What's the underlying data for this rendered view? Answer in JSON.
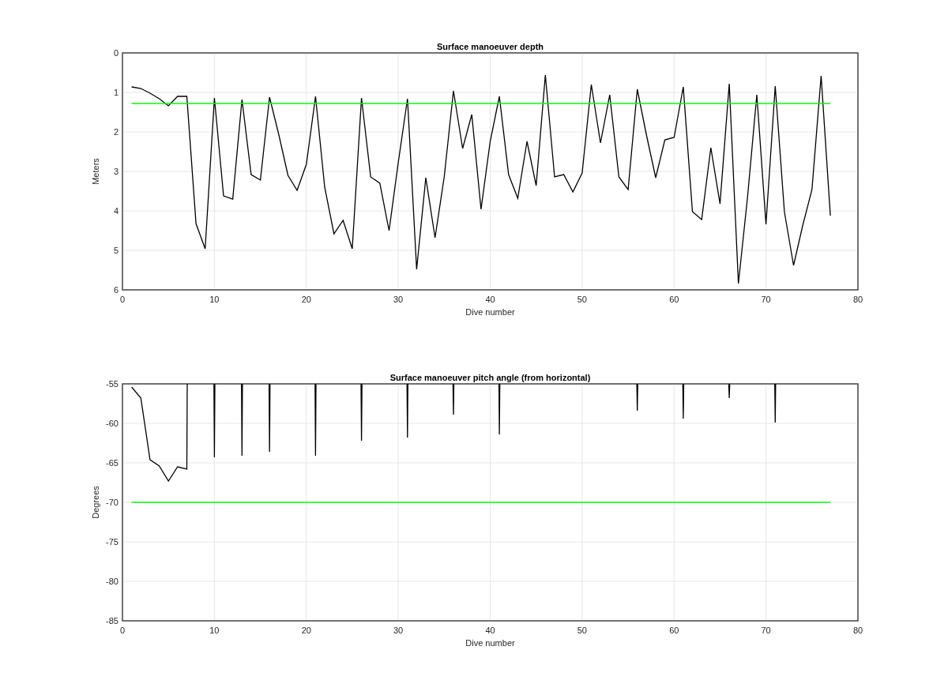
{
  "charts": [
    {
      "chart_data": {
        "type": "line",
        "title": "Surface manoeuver depth",
        "xlabel": "Dive number",
        "ylabel": "Meters",
        "grid": true,
        "xlim": [
          0,
          80
        ],
        "ylim": [
          6,
          0
        ],
        "xticks": [
          0,
          10,
          20,
          30,
          40,
          50,
          60,
          70,
          80
        ],
        "yticks": [
          0,
          1,
          2,
          3,
          4,
          5,
          6
        ],
        "x": [
          1,
          2,
          3,
          4,
          5,
          6,
          7,
          8,
          9,
          10,
          11,
          12,
          13,
          14,
          15,
          16,
          17,
          18,
          19,
          20,
          21,
          22,
          23,
          24,
          25,
          26,
          27,
          28,
          29,
          30,
          31,
          32,
          33,
          34,
          35,
          36,
          37,
          38,
          39,
          40,
          41,
          42,
          43,
          44,
          45,
          46,
          47,
          48,
          49,
          50,
          51,
          52,
          53,
          54,
          55,
          56,
          57,
          58,
          59,
          60,
          61,
          62,
          63,
          64,
          65,
          66,
          67,
          68,
          69,
          70,
          71,
          72,
          73,
          74,
          75,
          76,
          77
        ],
        "series": [
          {
            "color": "#000000",
            "values": [
              0.86,
              0.9,
              1.02,
              1.16,
              1.34,
              1.1,
              1.1,
              4.32,
              4.96,
              1.14,
              3.62,
              3.7,
              1.18,
              3.08,
              3.22,
              1.12,
              2.06,
              3.1,
              3.48,
              2.82,
              1.1,
              3.4,
              4.58,
              4.24,
              4.96,
              1.14,
              3.14,
              3.3,
              4.5,
              2.78,
              1.16,
              5.48,
              3.16,
              4.68,
              3.14,
              0.96,
              2.42,
              1.56,
              3.96,
              2.24,
              1.1,
              3.08,
              3.68,
              2.24,
              3.36,
              0.56,
              3.14,
              3.08,
              3.52,
              3.04,
              0.8,
              2.28,
              1.06,
              3.14,
              3.46,
              0.92,
              2.08,
              3.16,
              2.2,
              2.14,
              0.86,
              4.02,
              4.22,
              2.4,
              3.82,
              0.78,
              5.84,
              3.62,
              1.06,
              4.34,
              0.84,
              4.02,
              5.38,
              4.36,
              3.46,
              0.58,
              4.12
            ]
          },
          {
            "color": "#00ff00",
            "values": [
              1.28,
              1.28,
              1.28,
              1.28,
              1.28,
              1.28,
              1.28,
              1.28,
              1.28,
              1.28,
              1.28,
              1.28,
              1.28,
              1.28,
              1.28,
              1.28,
              1.28,
              1.28,
              1.28,
              1.28,
              1.28,
              1.28,
              1.28,
              1.28,
              1.28,
              1.28,
              1.28,
              1.28,
              1.28,
              1.28,
              1.28,
              1.28,
              1.28,
              1.28,
              1.28,
              1.28,
              1.28,
              1.28,
              1.28,
              1.28,
              1.28,
              1.28,
              1.28,
              1.28,
              1.28,
              1.28,
              1.28,
              1.28,
              1.28,
              1.28,
              1.28,
              1.28,
              1.28,
              1.28,
              1.28,
              1.28,
              1.28,
              1.28,
              1.28,
              1.28,
              1.28,
              1.28,
              1.28,
              1.28,
              1.28,
              1.28,
              1.28,
              1.28,
              1.28,
              1.28,
              1.28,
              1.28,
              1.28,
              1.28,
              1.28,
              1.28,
              1.28
            ]
          }
        ]
      }
    },
    {
      "chart_data": {
        "type": "line",
        "title": "Surface manoeuver pitch angle (from horizontal)",
        "xlabel": "Dive number",
        "ylabel": "Degrees",
        "grid": true,
        "xlim": [
          0,
          80
        ],
        "ylim": [
          -85,
          -55
        ],
        "xticks": [
          0,
          10,
          20,
          30,
          40,
          50,
          60,
          70,
          80
        ],
        "yticks": [
          -85,
          -80,
          -75,
          -70,
          -65,
          -60,
          -55
        ],
        "x": [
          1,
          2,
          3,
          4,
          5,
          6,
          7,
          7.05,
          7.1,
          9.95,
          10,
          10.05,
          10.1,
          12.95,
          13,
          13.05,
          13.1,
          15.95,
          16,
          16.05,
          16.1,
          20.95,
          21,
          21.05,
          21.1,
          25.95,
          26,
          26.05,
          26.1,
          30.95,
          31,
          31.05,
          31.1,
          35.95,
          36,
          36.05,
          36.1,
          40.95,
          41,
          41.05,
          41.1,
          55.95,
          56,
          56.05,
          56.1,
          60.95,
          61,
          61.05,
          61.1,
          65.95,
          66,
          66.05,
          66.1,
          70.95,
          71,
          71.05,
          77
        ],
        "series": [
          {
            "color": "#000000",
            "values": [
              -55.4,
              -56.8,
              -64.6,
              -65.4,
              -67.3,
              -65.5,
              -65.8,
              -55,
              null,
              -55,
              -64.3,
              -55,
              null,
              -55,
              -64.1,
              -55,
              null,
              -55,
              -63.6,
              -55,
              null,
              -55,
              -64.1,
              -55,
              null,
              -55,
              -62.2,
              -55,
              null,
              -55,
              -61.8,
              -55,
              null,
              -55,
              -58.9,
              -55,
              null,
              -55,
              -61.4,
              -55,
              null,
              -55,
              -58.4,
              -55,
              null,
              -55,
              -59.4,
              -55,
              null,
              -55,
              -56.8,
              -55,
              null,
              -55,
              -59.9,
              -55,
              null
            ]
          },
          {
            "color": "#00ff00",
            "values": [
              -70,
              -70,
              -70,
              -70,
              -70,
              -70,
              -70,
              -70,
              -70,
              -70,
              -70,
              -70,
              -70,
              -70,
              -70,
              -70,
              -70,
              -70,
              -70,
              -70,
              -70,
              -70,
              -70,
              -70,
              -70,
              -70,
              -70,
              -70,
              -70,
              -70,
              -70,
              -70,
              -70,
              -70,
              -70,
              -70,
              -70,
              -70,
              -70,
              -70,
              -70,
              -70,
              -70,
              -70,
              -70,
              -70,
              -70,
              -70,
              -70,
              -70,
              -70,
              -70,
              -70,
              -70,
              -70,
              -70,
              -70
            ]
          }
        ]
      }
    }
  ]
}
